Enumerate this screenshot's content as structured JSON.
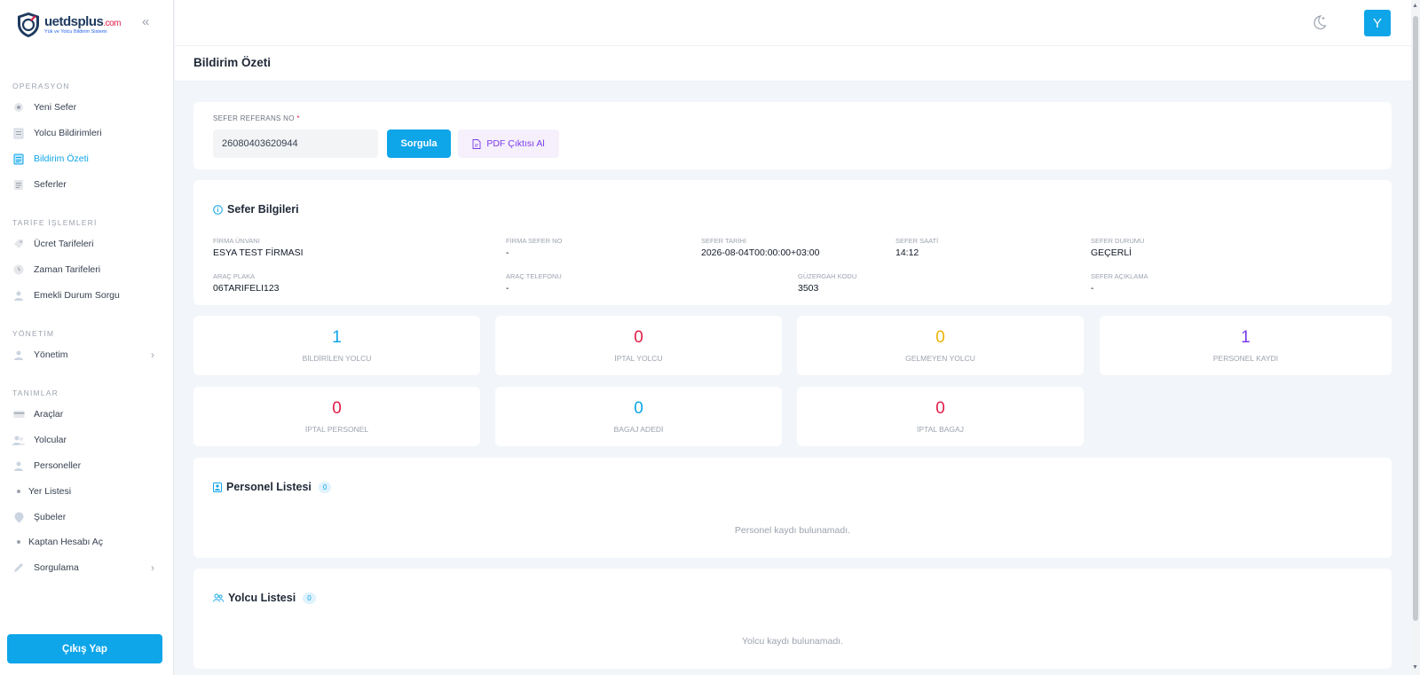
{
  "brand": {
    "name": "uetdsplus",
    "suffix": ".com",
    "tagline": "Yük ve Yolcu Bildirim Sistemi"
  },
  "sidebar": {
    "sections": [
      {
        "label": "OPERASYON",
        "items": [
          {
            "label": "Yeni Sefer",
            "icon": "map-pin-icon"
          },
          {
            "label": "Yolcu Bildirimleri",
            "icon": "clipboard-icon"
          },
          {
            "label": "Bildirim Özeti",
            "icon": "document-icon",
            "active": true
          },
          {
            "label": "Seferler",
            "icon": "list-icon"
          }
        ]
      },
      {
        "label": "TARİFE İŞLEMLERİ",
        "items": [
          {
            "label": "Ücret Tarifeleri",
            "icon": "tag-icon"
          },
          {
            "label": "Zaman Tarifeleri",
            "icon": "clock-icon"
          },
          {
            "label": "Emekli Durum Sorgu",
            "icon": "user-icon"
          }
        ]
      },
      {
        "label": "YÖNETİM",
        "items": [
          {
            "label": "Yönetim",
            "icon": "user-icon"
          }
        ]
      },
      {
        "label": "TANIMLAR",
        "items": [
          {
            "label": "Araçlar",
            "icon": "card-icon"
          },
          {
            "label": "Yolcular",
            "icon": "users-icon"
          },
          {
            "label": "Personeller",
            "icon": "user-icon"
          },
          {
            "label": "Yer Listesi",
            "icon": "dot-icon"
          },
          {
            "label": "Şubeler",
            "icon": "location-icon"
          },
          {
            "label": "Kaptan Hesabı Aç",
            "icon": "dot-icon"
          },
          {
            "label": "Sorgulama",
            "icon": "pen-icon"
          }
        ]
      }
    ],
    "logout_label": "Çıkış Yap"
  },
  "topbar": {
    "avatar_letter": "Y"
  },
  "page": {
    "title": "Bildirim Özeti"
  },
  "search": {
    "label": "SEFER REFERANS NO",
    "required_mark": "*",
    "value": "26080403620944",
    "query_button": "Sorgula",
    "pdf_button": "PDF Çıktısı Al"
  },
  "trip": {
    "title": "Sefer Bilgileri",
    "fields": {
      "company_label": "FİRMA ÜNVANI",
      "company": "ESYA TEST FİRMASI",
      "company_trip_no_label": "FİRMA SEFER NO",
      "company_trip_no": "-",
      "date_label": "SEFER TARİHİ",
      "date": "2026-08-04T00:00:00+03:00",
      "time_label": "SEFER SAATİ",
      "time": "14:12",
      "status_label": "SEFER DURUMU",
      "status": "GEÇERLİ",
      "plate_label": "ARAÇ PLAKA",
      "plate": "06TARIFELI123",
      "phone_label": "ARAÇ TELEFONU",
      "phone": "-",
      "route_label": "GÜZERGAH KODU",
      "route": "3503",
      "desc_label": "SEFER AÇIKLAMA",
      "desc": "-"
    }
  },
  "stats": [
    {
      "value": "1",
      "label": "BİLDİRİLEN YOLCU",
      "color": "#0ea5e9"
    },
    {
      "value": "0",
      "label": "İPTAL YOLCU",
      "color": "#e11d48"
    },
    {
      "value": "0",
      "label": "GELMEYEN YOLCU",
      "color": "#eab308"
    },
    {
      "value": "1",
      "label": "PERSONEL KAYDI",
      "color": "#7c3aed"
    },
    {
      "value": "0",
      "label": "İPTAL PERSONEL",
      "color": "#e11d48"
    },
    {
      "value": "0",
      "label": "BAGAJ ADEDİ",
      "color": "#0ea5e9"
    },
    {
      "value": "0",
      "label": "İPTAL BAGAJ",
      "color": "#e11d48"
    }
  ],
  "staff_list": {
    "title": "Personel Listesi",
    "count": "0",
    "empty": "Personel kaydı bulunamadı."
  },
  "passenger_list": {
    "title": "Yolcu Listesi",
    "count": "0",
    "empty": "Yolcu kaydı bulunamadı."
  }
}
